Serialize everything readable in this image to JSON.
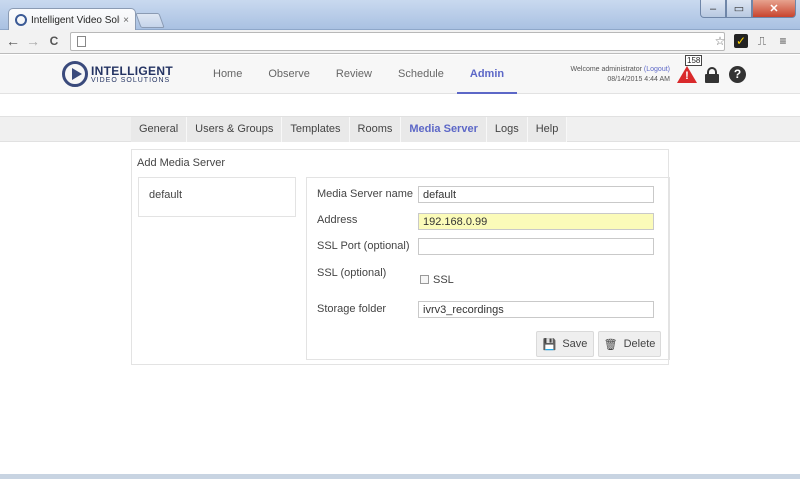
{
  "browser": {
    "tab_title": "Intelligent Video Solutions",
    "tab_close": "×",
    "window_buttons": {
      "minimize": "–",
      "maximize": "▭",
      "close": "✕"
    },
    "nav": {
      "back": "←",
      "forward": "→",
      "reload": "C"
    }
  },
  "app": {
    "logo": {
      "line1": "INTELLIGENT",
      "line2": "VIDEO SOLUTIONS"
    },
    "nav": [
      {
        "label": "Home"
      },
      {
        "label": "Observe"
      },
      {
        "label": "Review"
      },
      {
        "label": "Schedule"
      },
      {
        "label": "Admin",
        "active": true
      }
    ],
    "welcome": {
      "text": "Welcome administrator",
      "logout": "(Logout)",
      "datetime": "08/14/2015  4:44 AM"
    },
    "alerts": {
      "count": "158",
      "mark": "!"
    },
    "help_mark": "?"
  },
  "subnav": [
    {
      "label": "General"
    },
    {
      "label": "Users & Groups"
    },
    {
      "label": "Templates"
    },
    {
      "label": "Rooms"
    },
    {
      "label": "Media Server",
      "active": true
    },
    {
      "label": "Logs"
    },
    {
      "label": "Help"
    }
  ],
  "panel": {
    "title": "Add Media Server",
    "servers": [
      "default"
    ],
    "form": {
      "name_label": "Media Server name",
      "name_value": "default",
      "address_label": "Address",
      "address_value": "192.168.0.99",
      "ssl_port_label": "SSL Port (optional)",
      "ssl_port_value": "",
      "ssl_label": "SSL (optional)",
      "ssl_checkbox_label": "SSL",
      "ssl_checked": false,
      "storage_label": "Storage folder",
      "storage_value": "ivrv3_recordings"
    },
    "buttons": {
      "save": "Save",
      "delete": "Delete"
    }
  },
  "colors": {
    "accent": "#5c67c7",
    "alert": "#d9292b",
    "highlight_field": "#fbfbb9"
  }
}
